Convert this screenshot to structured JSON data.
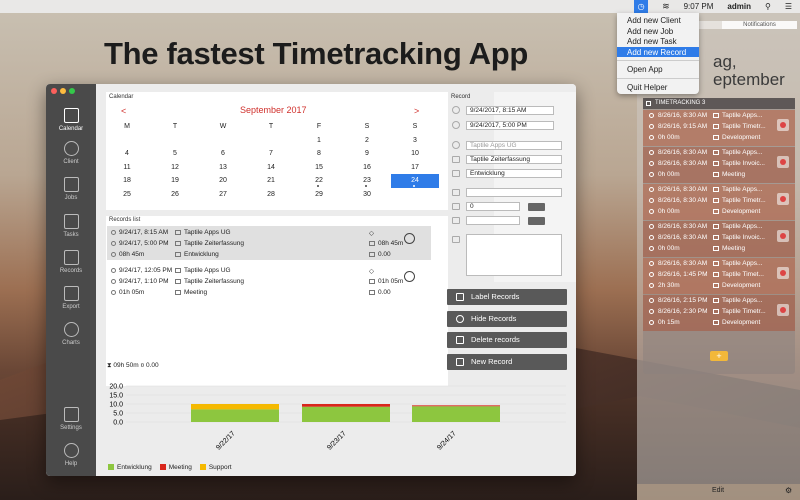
{
  "menubar": {
    "time": "9:07 PM",
    "user": "admin"
  },
  "menu": {
    "items": [
      "Add new Client",
      "Add new Job",
      "Add new Task",
      "Add new Record",
      "Open App",
      "Quit Helper"
    ],
    "selected": "Add new Record"
  },
  "headline": "The fastest Timetracking App",
  "background_text": {
    "line1": "ag,",
    "line2": "eptember"
  },
  "notification_center": {
    "tab": "Notifications",
    "widget_title": "TIMETRACKING 3",
    "records": [
      {
        "start": "8/26/16, 8:30 AM",
        "end": "8/26/16, 9:15 AM",
        "duration": "0h 00m",
        "client": "Taptile Apps...",
        "job": "Taptile Timetr...",
        "task": "Development"
      },
      {
        "start": "8/26/16, 8:30 AM",
        "end": "8/26/16, 8:30 AM",
        "duration": "0h 00m",
        "client": "Taptile Apps...",
        "job": "Taptile Invoic...",
        "task": "Meeting"
      },
      {
        "start": "8/26/16, 8:30 AM",
        "end": "8/26/16, 8:30 AM",
        "duration": "0h 00m",
        "client": "Taptile Apps...",
        "job": "Taptile Timetr...",
        "task": "Development"
      },
      {
        "start": "8/26/16, 8:30 AM",
        "end": "8/26/16, 8:30 AM",
        "duration": "0h 00m",
        "client": "Taptile Apps...",
        "job": "Taptile Invoic...",
        "task": "Meeting"
      },
      {
        "start": "8/26/16, 8:30 AM",
        "end": "8/26/16, 1:45 PM",
        "duration": "2h 30m",
        "client": "Taptile Apps...",
        "job": "Taptile Timet...",
        "task": "Development"
      },
      {
        "start": "8/26/16, 2:15 PM",
        "end": "8/26/16, 2:30 PM",
        "duration": "0h 15m",
        "client": "Taptile Apps...",
        "job": "Taptile Timetr...",
        "task": "Development"
      }
    ],
    "add_label": "+",
    "edit_label": "Edit"
  },
  "window": {
    "sidebar": [
      "Calendar",
      "Client",
      "Jobs",
      "Tasks",
      "Records",
      "Export",
      "Charts",
      "Settings",
      "Help"
    ],
    "active": "Calendar"
  },
  "calendar": {
    "section": "Calendar",
    "month": "September 2017",
    "prev": "<",
    "next": ">",
    "weekdays": [
      "M",
      "T",
      "W",
      "T",
      "F",
      "S",
      "S"
    ],
    "weeks": [
      [
        "",
        "",
        "",
        "",
        "1",
        "2",
        "3"
      ],
      [
        "4",
        "5",
        "6",
        "7",
        "8",
        "9",
        "10"
      ],
      [
        "11",
        "12",
        "13",
        "14",
        "15",
        "16",
        "17"
      ],
      [
        "18",
        "19",
        "20",
        "21",
        "22",
        "23",
        "24"
      ],
      [
        "25",
        "26",
        "27",
        "28",
        "29",
        "30",
        ""
      ]
    ],
    "selected_day": "24",
    "dotted_days": [
      "22",
      "23",
      "24"
    ]
  },
  "records_list": {
    "section": "Records list",
    "records": [
      {
        "start": "9/24/17, 8:15 AM",
        "end": "9/24/17, 5:00 PM",
        "duration": "08h 45m",
        "client": "Taptile Apps UG",
        "job": "Taptile Zeiterfassung",
        "task": "Entwicklung",
        "time_value": "08h 45m",
        "amount": "0.00"
      },
      {
        "start": "9/24/17, 12:05 PM",
        "end": "9/24/17, 1:10 PM",
        "duration": "01h 05m",
        "client": "Taptile Apps UG",
        "job": "Taptile Zeiterfassung",
        "task": "Meeting",
        "time_value": "01h 05m",
        "amount": "0.00"
      }
    ],
    "total_time": "09h 50m",
    "total_amount": "0.00"
  },
  "record_form": {
    "section": "Record",
    "start": "9/24/2017, 8:15 AM",
    "end": "9/24/2017, 5:00 PM",
    "client_placeholder": "Taptile Apps UG",
    "job": "Taptile Zeiterfassung",
    "task": "Entwicklung",
    "rate": "0"
  },
  "buttons": {
    "label": "Label Records",
    "hide": "Hide Records",
    "delete": "Delete records",
    "new": "New Record"
  },
  "chart_data": {
    "type": "bar",
    "categories": [
      "9/22/17",
      "9/23/17",
      "9/24/17"
    ],
    "series": [
      {
        "name": "Entwicklung",
        "color": "#8dc63f",
        "values": [
          7.0,
          8.5,
          8.75
        ]
      },
      {
        "name": "Meeting",
        "color": "#d9261c",
        "values": [
          0.0,
          1.5,
          0.5
        ]
      },
      {
        "name": "Support",
        "color": "#f5b900",
        "values": [
          3.0,
          0.0,
          0.0
        ]
      }
    ],
    "stacked": true,
    "yticks": [
      "20.0",
      "15.0",
      "10.0",
      "5.0",
      "0.0"
    ],
    "ylim": [
      0,
      20
    ],
    "legend_position": "bottom-left"
  }
}
